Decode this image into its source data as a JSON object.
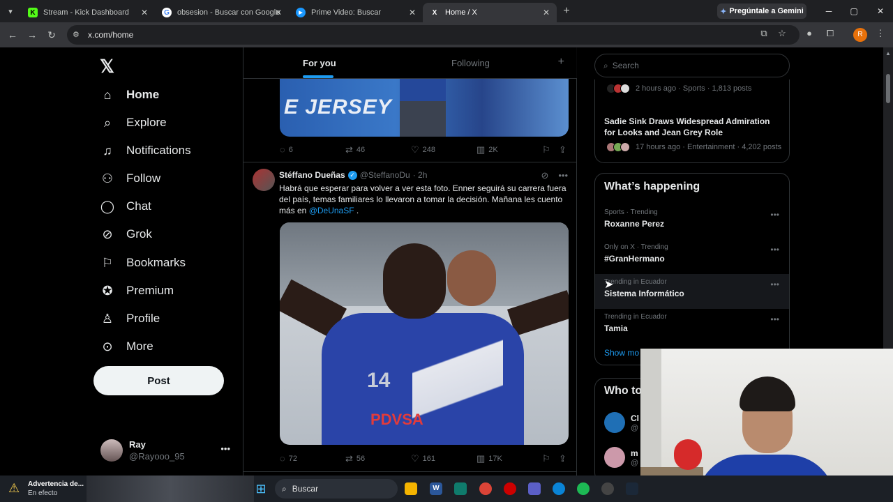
{
  "browser": {
    "tabs": [
      {
        "title": "Stream - Kick Dashboard",
        "favicon": "K"
      },
      {
        "title": "obsesion - Buscar con Google",
        "favicon": "G"
      },
      {
        "title": "Prime Video: Buscar",
        "favicon": "▶"
      },
      {
        "title": "Home / X",
        "favicon": "X"
      }
    ],
    "gemini_label": "Pregúntale a Gemini",
    "url": "x.com/home",
    "profile_initial": "R"
  },
  "x": {
    "nav": [
      {
        "label": "Home",
        "icon": "home-icon",
        "glyph": "⌂"
      },
      {
        "label": "Explore",
        "icon": "search-icon",
        "glyph": "⌕"
      },
      {
        "label": "Notifications",
        "icon": "bell-icon",
        "glyph": "♫"
      },
      {
        "label": "Follow",
        "icon": "person-add-icon",
        "glyph": "⚇"
      },
      {
        "label": "Chat",
        "icon": "chat-icon",
        "glyph": "◯"
      },
      {
        "label": "Grok",
        "icon": "grok-icon",
        "glyph": "⊘"
      },
      {
        "label": "Bookmarks",
        "icon": "bookmark-icon",
        "glyph": "⚐"
      },
      {
        "label": "Premium",
        "icon": "premium-icon",
        "glyph": "✪"
      },
      {
        "label": "Profile",
        "icon": "profile-icon",
        "glyph": "♙"
      },
      {
        "label": "More",
        "icon": "more-icon",
        "glyph": "⊙"
      }
    ],
    "post_button": "Post",
    "account": {
      "name": "Ray",
      "handle": "@Rayooo_95"
    },
    "feed_tabs": {
      "for_you": "For you",
      "following": "Following"
    },
    "tweet1": {
      "image_text": "E JERSEY",
      "replies": "6",
      "reposts": "46",
      "likes": "248",
      "views": "2K"
    },
    "tweet2": {
      "name": "Stéffano Dueñas",
      "handle": "@SteffanoDu",
      "time": "· 2h",
      "text": "Habrá que esperar para volver a ver esta foto. Enner seguirá su carrera fuera del país, temas familiares lo llevaron a tomar la decisión. Mañana les cuento más en ",
      "mention": "@DeUnaSF",
      "text_end": " .",
      "jersey_number": "14",
      "sponsor": "PDVSA",
      "replies": "72",
      "reposts": "56",
      "likes": "161",
      "views": "17K"
    },
    "search_placeholder": "Search",
    "trend_box": {
      "item1_meta": "2 hours ago · Sports · 1,813 posts",
      "item2_title": "Sadie Sink Draws Widespread Admiration for Looks and Jean Grey Role",
      "item2_meta": "17 hours ago · Entertainment · 4,202 posts"
    },
    "whats_happening": {
      "title": "What’s happening",
      "trends": [
        {
          "context": "Sports · Trending",
          "name": "Roxanne Perez"
        },
        {
          "context": "Only on X · Trending",
          "name": "#GranHermano"
        },
        {
          "context": "Trending in Ecuador",
          "name": "Sistema Informático"
        },
        {
          "context": "Trending in Ecuador",
          "name": "Tamia"
        }
      ],
      "show_more": "Show mo"
    },
    "who_to_follow": {
      "title": "Who to",
      "items": [
        {
          "name": "Cl",
          "handle": "@"
        },
        {
          "name": "m",
          "handle": "@"
        }
      ]
    }
  },
  "taskbar": {
    "warning_title": "Advertencia de...",
    "warning_sub": "En efecto",
    "search_placeholder": "Buscar"
  }
}
